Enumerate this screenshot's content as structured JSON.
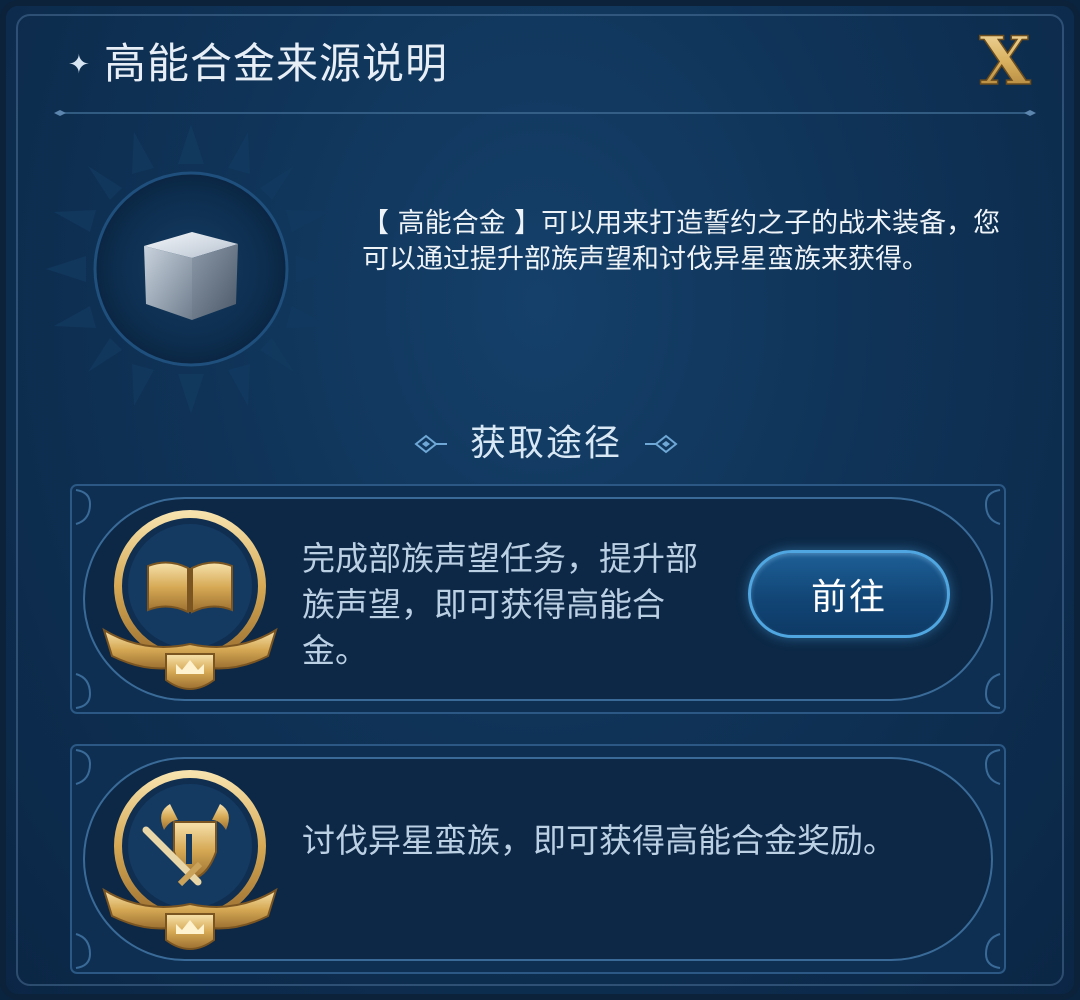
{
  "dialog": {
    "title": "高能合金来源说明",
    "sparkle_icon": "sparkle-icon",
    "close_icon": "close-x-icon",
    "close_label": "X"
  },
  "item": {
    "name": "高能合金",
    "icon": "metal-cube-icon",
    "description": "【 高能合金 】可以用来打造誓约之子的战术装备，您可以通过提升部族声望和讨伐异星蛮族来获得。"
  },
  "section": {
    "title": "获取途径"
  },
  "methods": [
    {
      "icon": "book-badge-icon",
      "text": "完成部族声望任务，提升部族声望，即可获得高能合金。",
      "button_label": "前往"
    },
    {
      "icon": "horned-helmet-sword-badge-icon",
      "text": "讨伐异星蛮族，即可获得高能合金奖励。"
    }
  ],
  "colors": {
    "background": "#0f3357",
    "gold": "#d9b160",
    "button_border": "#4fa6e0",
    "text": "#bcd0e4"
  }
}
